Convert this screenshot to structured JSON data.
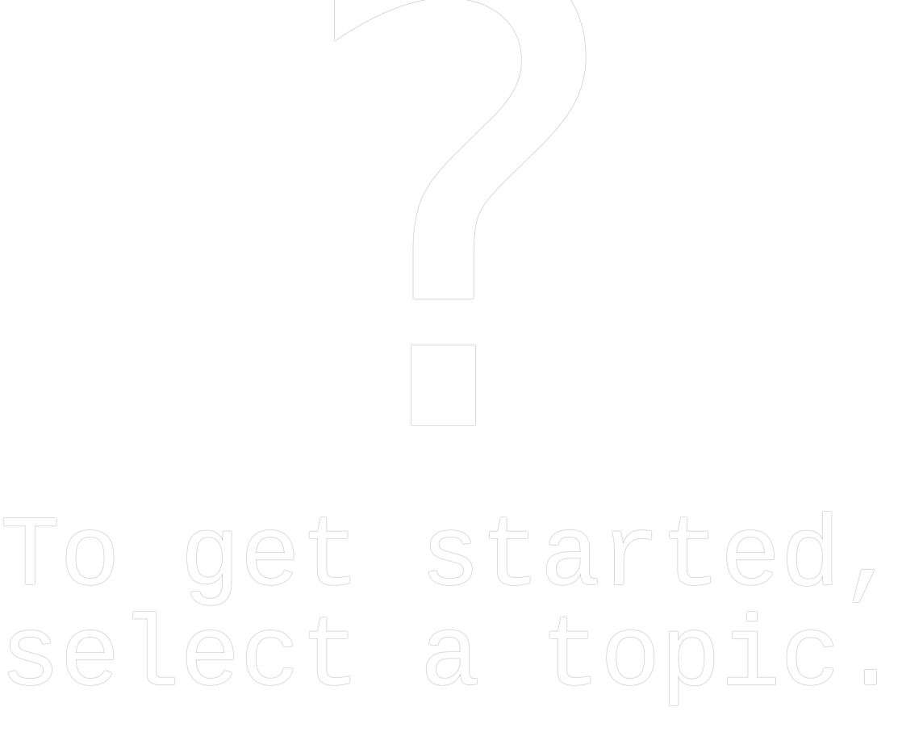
{
  "placeholder": {
    "icon": "question-mark-icon",
    "glyph": "?",
    "message_line_1": "To get started,",
    "message_line_2": "select a topic."
  },
  "colors": {
    "background": "#ffffff",
    "text": "#ffffff",
    "outline": "#c8c8c8"
  }
}
